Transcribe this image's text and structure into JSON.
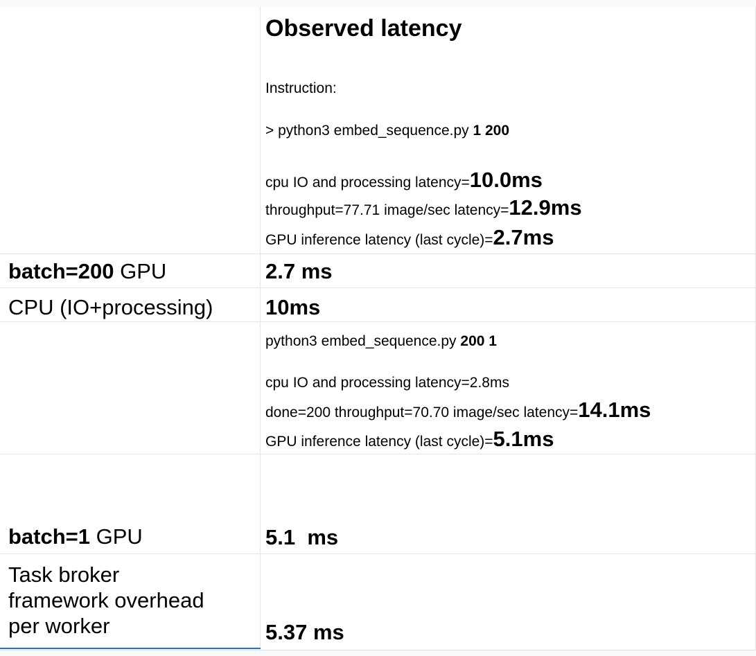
{
  "header": {
    "title": "Observed latency",
    "instruction_label": "Instruction:",
    "cmd1_prefix": "> python3 embed_sequence.py ",
    "cmd1_args": "1 200",
    "line1_text": "cpu IO and processing latency=",
    "line1_value": "10.0ms",
    "line2_text": "throughput=77.71 image/sec latency=",
    "line2_value": "12.9ms",
    "line3_text": "GPU inference latency (last cycle)=",
    "line3_value": "2.7ms"
  },
  "row_batch200": {
    "label_bold": "batch=200",
    "label_rest": " GPU",
    "value": "2.7 ms"
  },
  "row_cpu": {
    "label": "CPU (IO+processing)",
    "value": "10ms"
  },
  "block2": {
    "cmd_prefix": "python3 embed_sequence.py ",
    "cmd_args": "200 1",
    "line1": "cpu IO and processing latency=2.8ms",
    "line2_text": "done=200 throughput=70.70 image/sec latency=",
    "line2_value": "14.1ms",
    "line3_text": "GPU inference latency (last cycle)=",
    "line3_value": "5.1ms"
  },
  "row_batch1": {
    "label_bold": "batch=1",
    "label_rest": " GPU",
    "value": "5.1  ms"
  },
  "row_broker": {
    "label_line1": "Task broker",
    "label_line2": "framework overhead",
    "label_line3": "per worker",
    "value": "5.37 ms"
  }
}
